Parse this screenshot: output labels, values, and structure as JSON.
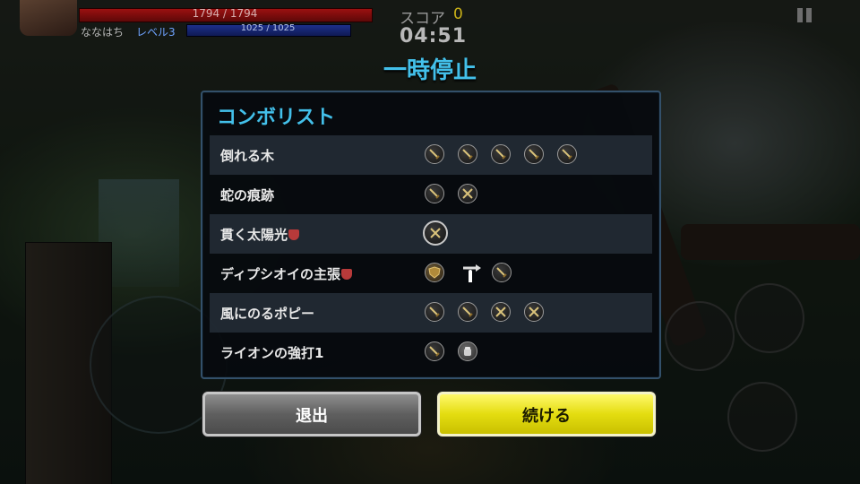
{
  "hud": {
    "hp_text": "1794 / 1794",
    "hp_fraction": 1.0,
    "mp_text": "1025 / 1025",
    "mp_fraction": 1.0,
    "player_name": "ななはち",
    "player_level": "レベル3",
    "score_label": "スコア",
    "score_value": "0",
    "timer": "04:51"
  },
  "dialog": {
    "title": "一時停止",
    "panel_title": "コンボリスト",
    "combos": [
      {
        "name": "倒れる木",
        "marked": false,
        "inputs": [
          "sword",
          "sword",
          "sword",
          "sword",
          "sword"
        ]
      },
      {
        "name": "蛇の痕跡",
        "marked": false,
        "inputs": [
          "sword",
          "cross-swords"
        ]
      },
      {
        "name": "貫く太陽光",
        "marked": true,
        "inputs": [
          "cross-swords-big"
        ]
      },
      {
        "name": "ディプシオイの主張",
        "marked": true,
        "inputs": [
          "shield",
          "swipe",
          "sword"
        ]
      },
      {
        "name": "風にのるポピー",
        "marked": false,
        "inputs": [
          "sword",
          "sword",
          "cross-swords",
          "cross-swords"
        ]
      },
      {
        "name": "ライオンの強打1",
        "marked": false,
        "inputs": [
          "sword",
          "fist"
        ]
      }
    ],
    "exit_label": "退出",
    "continue_label": "続ける"
  },
  "colors": {
    "accent": "#43c0ea",
    "continue_button": "#e4dd10",
    "exit_button": "#6a6a6a"
  }
}
